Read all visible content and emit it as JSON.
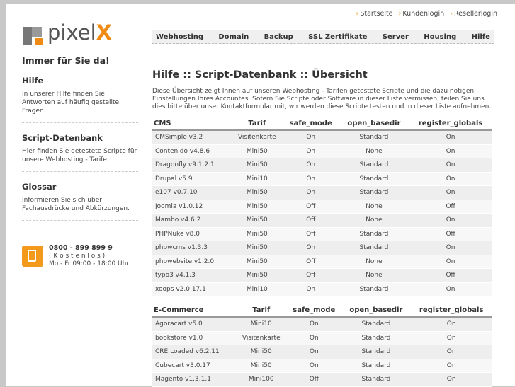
{
  "toplinks": [
    {
      "label": "Startseite"
    },
    {
      "label": "Kundenlogin"
    },
    {
      "label": "Resellerlogin"
    }
  ],
  "logo": {
    "text": "pixel",
    "mark": "X"
  },
  "nav": [
    "Webhosting",
    "Domain",
    "Backup",
    "SSL Zertifikate",
    "Server",
    "Housing",
    "Hilfe"
  ],
  "sidebar": {
    "slogan": "Immer für Sie da!",
    "sections": [
      {
        "title": "Hilfe",
        "text": "In unserer Hilfe finden Sie Antworten auf häufig gestellte Fragen."
      },
      {
        "title": "Script-Datenbank",
        "text": "Hier finden Sie getestete Scripte für unsere Webhosting - Tarife."
      },
      {
        "title": "Glossar",
        "text": "Informieren Sie sich über Fachausdrücke und Abkürzungen."
      }
    ],
    "phone": {
      "number": "0800 - 899 899 9",
      "note": "( K o s t e n l o s )",
      "hours": "Mo - Fr  09:00 - 18:00 Uhr"
    }
  },
  "main": {
    "title": "Hilfe :: Script-Datenbank :: Übersicht",
    "intro": "Diese Übersicht zeigt Ihnen auf unseren Webhosting - Tarifen getestete Scripte und die dazu nötigen Einstellungen Ihres Accountes. Sofern Sie Scripte oder Software in dieser Liste vermissen, teilen Sie uns dies bitte über unser Kontaktformular mit, wir werden diese Scripte testen und in dieser Liste aufnehmen.",
    "columns": [
      "Tarif",
      "safe_mode",
      "open_basedir",
      "register_globals"
    ],
    "groups": [
      {
        "name": "CMS",
        "rows": [
          [
            "CMSimple v3.2",
            "Visitenkarte",
            "On",
            "Standard",
            "On"
          ],
          [
            "Contenido v4.8.6",
            "Mini50",
            "On",
            "None",
            "On"
          ],
          [
            "Dragonfly v9.1.2.1",
            "Mini50",
            "On",
            "Standard",
            "On"
          ],
          [
            "Drupal v5.9",
            "Mini10",
            "On",
            "Standard",
            "On"
          ],
          [
            "e107 v0.7.10",
            "Mini50",
            "On",
            "Standard",
            "On"
          ],
          [
            "Joomla v1.0.12",
            "Mini50",
            "Off",
            "None",
            "Off"
          ],
          [
            "Mambo v4.6.2",
            "Mini50",
            "Off",
            "None",
            "On"
          ],
          [
            "PHPNuke v8.0",
            "Mini50",
            "Off",
            "Standard",
            "Off"
          ],
          [
            "phpwcms v1.3.3",
            "Mini50",
            "On",
            "Standard",
            "On"
          ],
          [
            "phpwebsite v1.2.0",
            "Mini50",
            "Off",
            "None",
            "On"
          ],
          [
            "typo3 v4.1.3",
            "Mini50",
            "Off",
            "None",
            "Off"
          ],
          [
            "xoops v2.0.17.1",
            "Mini10",
            "On",
            "Standard",
            "On"
          ]
        ]
      },
      {
        "name": "E-Commerce",
        "rows": [
          [
            "Agoracart v5.0",
            "Mini10",
            "On",
            "Standard",
            "On"
          ],
          [
            "bookstore v1.0",
            "Visitenkarte",
            "On",
            "Standard",
            "On"
          ],
          [
            "CRE Loaded v6.2.11",
            "Mini50",
            "On",
            "Standard",
            "On"
          ],
          [
            "Cubecart v3.0.17",
            "Mini50",
            "On",
            "Standard",
            "On"
          ],
          [
            "Magento v1.3.1.1",
            "Mini100",
            "Off",
            "Standard",
            "On"
          ]
        ]
      }
    ]
  }
}
